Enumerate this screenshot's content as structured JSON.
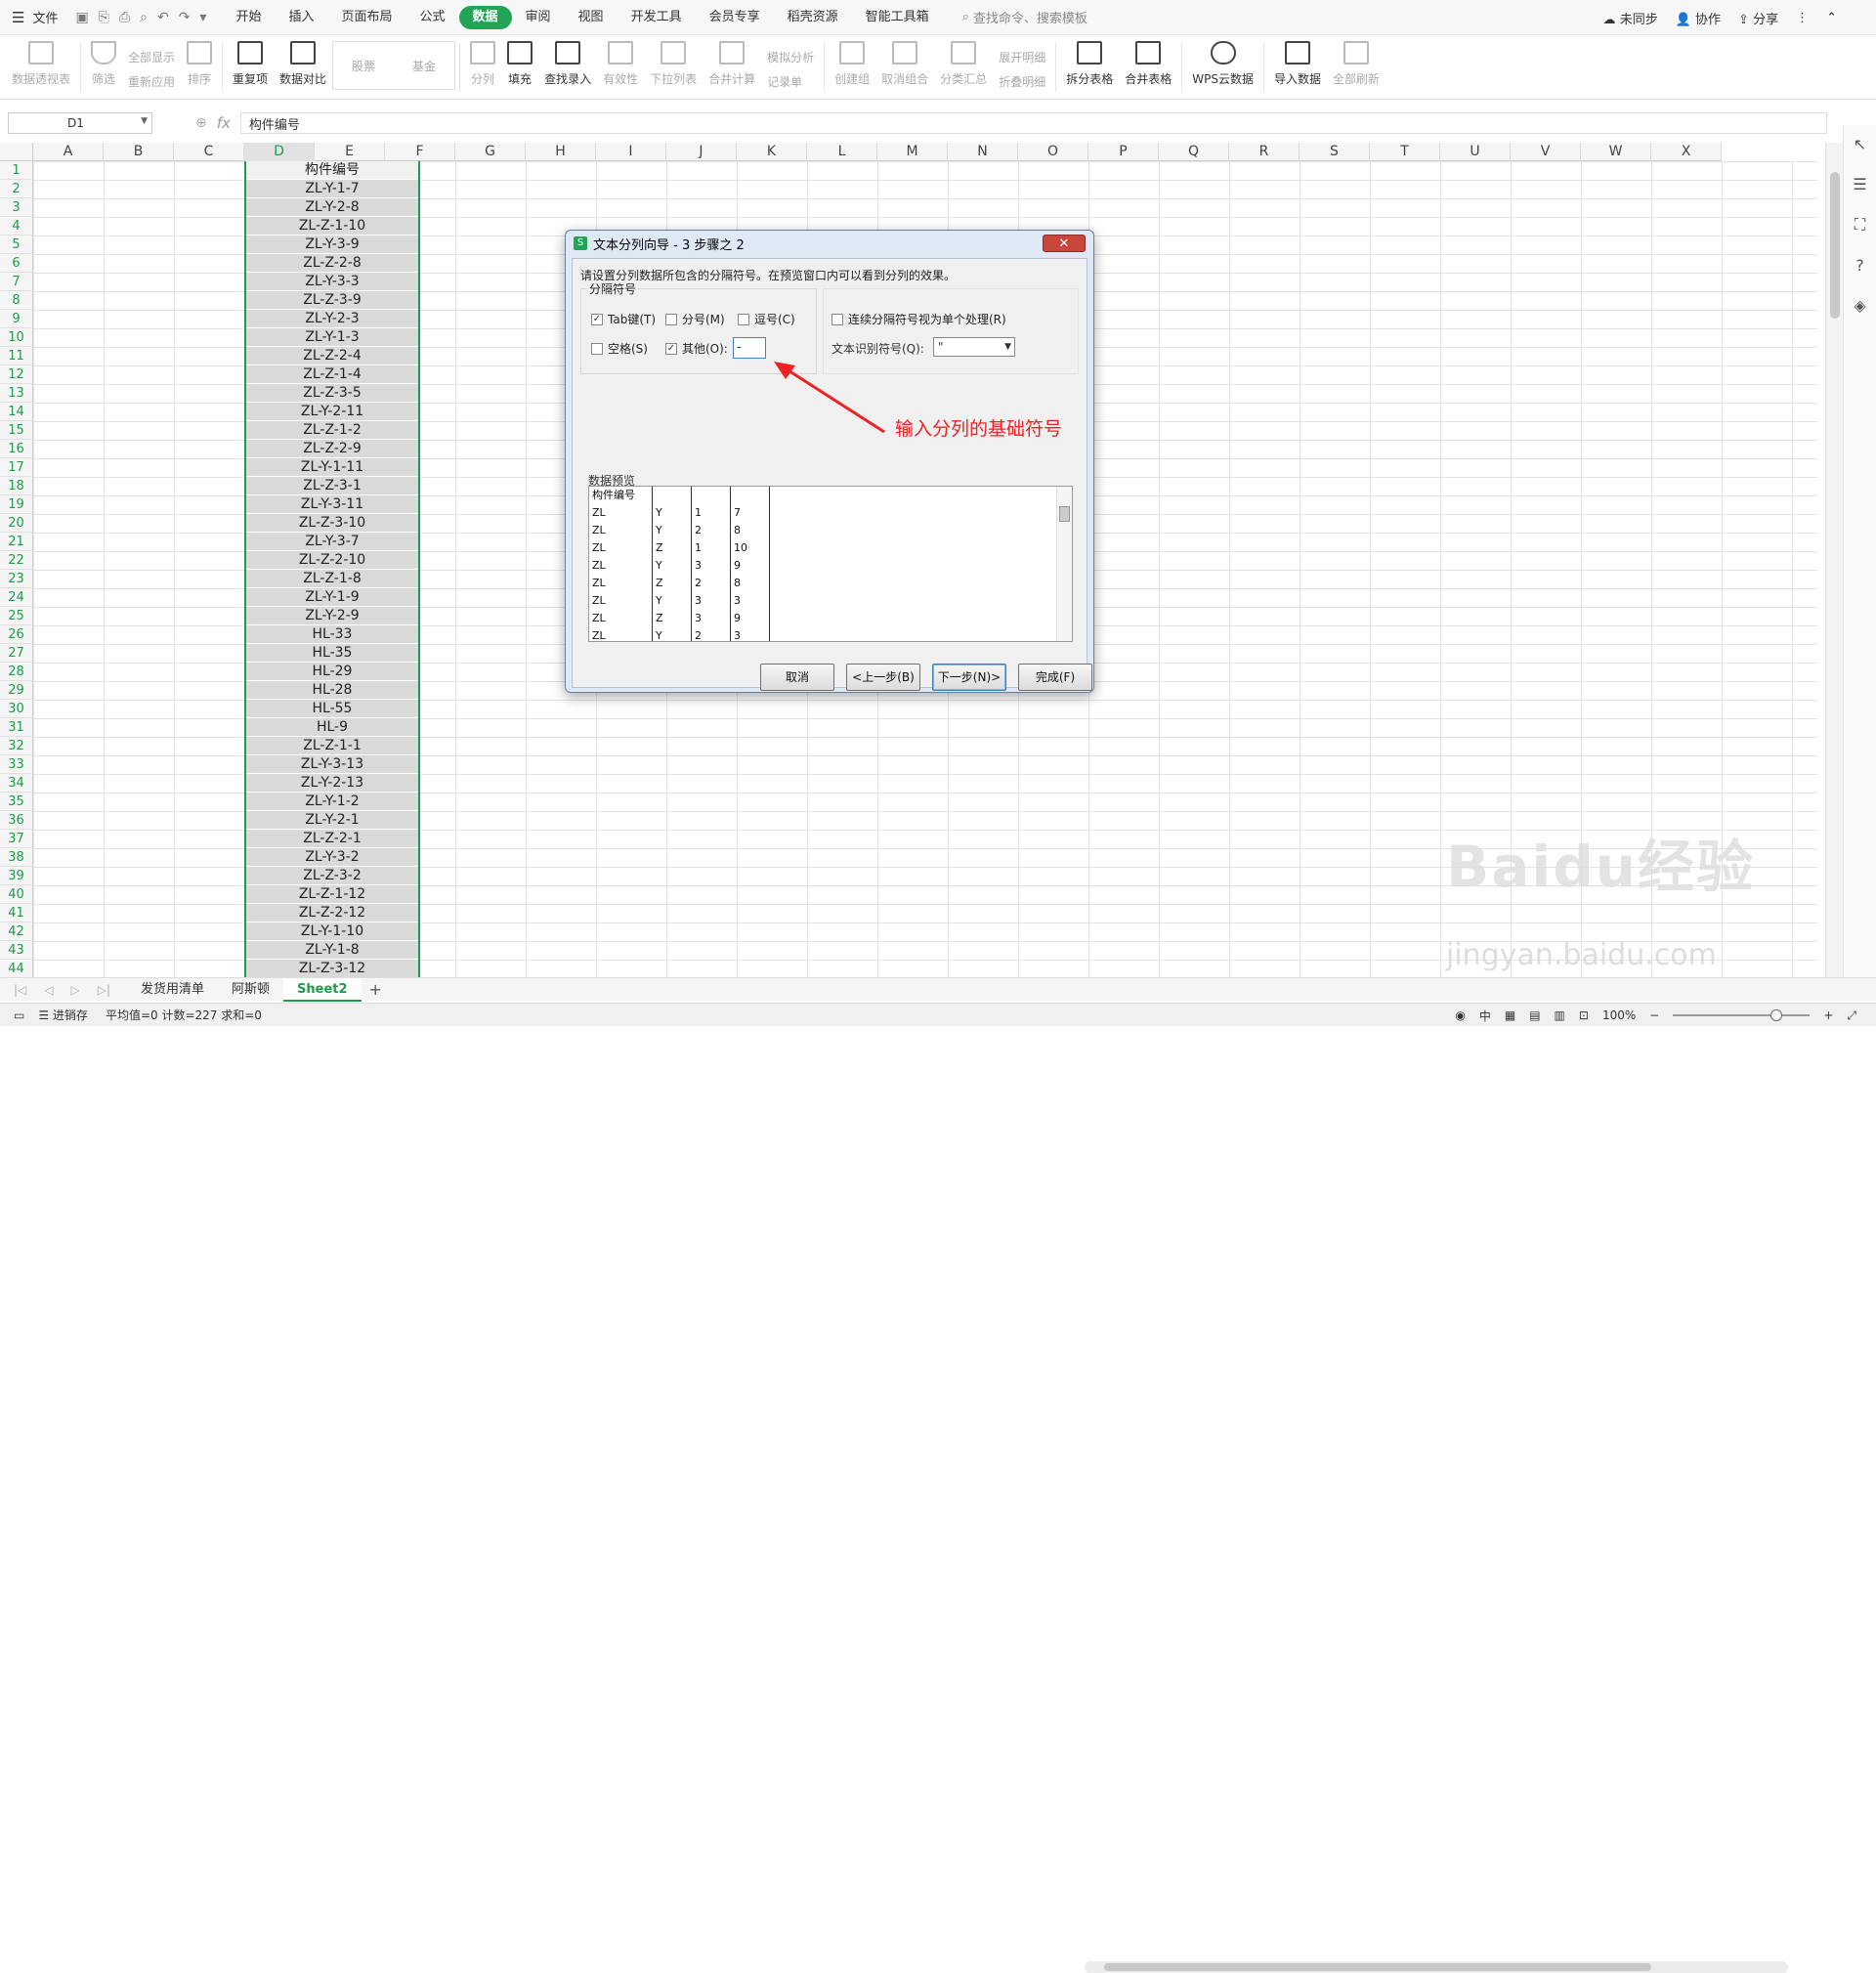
{
  "topbar": {
    "file_menu": "文件",
    "tabs": [
      "开始",
      "插入",
      "页面布局",
      "公式",
      "数据",
      "审阅",
      "视图",
      "开发工具",
      "会员专享",
      "稻壳资源",
      "智能工具箱"
    ],
    "active_tab": "数据",
    "search_placeholder": "查找命令、搜索模板",
    "sync": "未同步",
    "collab": "协作",
    "share": "分享"
  },
  "ribbon": {
    "pivot": "数据透视表",
    "filter": "筛选",
    "show_all": "全部显示",
    "reapply": "重新应用",
    "sort": "排序",
    "dup": "重复项",
    "compare": "数据对比",
    "stock": "股票",
    "fund": "基金",
    "split": "分列",
    "fill": "填充",
    "find_entry": "查找录入",
    "validity": "有效性",
    "dropdown": "下拉列表",
    "consolidate": "合并计算",
    "simulate": "模拟分析",
    "record": "记录单",
    "create_group": "创建组",
    "ungroup": "取消组合",
    "subtotal": "分类汇总",
    "expand": "展开明细",
    "collapse": "折叠明细",
    "split_table": "拆分表格",
    "merge_table": "合并表格",
    "wps_cloud": "WPS云数据",
    "import": "导入数据",
    "refresh": "全部刷新"
  },
  "formula_bar": {
    "cell": "D1",
    "fx": "fx",
    "value": "构件编号"
  },
  "columns": [
    "A",
    "B",
    "C",
    "D",
    "E",
    "F",
    "G",
    "H",
    "I",
    "J",
    "K",
    "L",
    "M",
    "N",
    "O",
    "P",
    "Q",
    "R",
    "S",
    "T",
    "U",
    "V",
    "W",
    "X"
  ],
  "selected_column": "D",
  "rows": [
    "1",
    "2",
    "3",
    "4",
    "5",
    "6",
    "7",
    "8",
    "9",
    "10",
    "11",
    "12",
    "13",
    "14",
    "15",
    "16",
    "17",
    "18",
    "19",
    "20",
    "21",
    "22",
    "23",
    "24",
    "25",
    "26",
    "27",
    "28",
    "29",
    "30",
    "31",
    "32",
    "33",
    "34",
    "35",
    "36",
    "37",
    "38",
    "39",
    "40",
    "41",
    "42",
    "43",
    "44"
  ],
  "d_values": [
    "构件编号",
    "ZL-Y-1-7",
    "ZL-Y-2-8",
    "ZL-Z-1-10",
    "ZL-Y-3-9",
    "ZL-Z-2-8",
    "ZL-Y-3-3",
    "ZL-Z-3-9",
    "ZL-Y-2-3",
    "ZL-Y-1-3",
    "ZL-Z-2-4",
    "ZL-Z-1-4",
    "ZL-Z-3-5",
    "ZL-Y-2-11",
    "ZL-Z-1-2",
    "ZL-Z-2-9",
    "ZL-Y-1-11",
    "ZL-Z-3-1",
    "ZL-Y-3-11",
    "ZL-Z-3-10",
    "ZL-Y-3-7",
    "ZL-Z-2-10",
    "ZL-Z-1-8",
    "ZL-Y-1-9",
    "ZL-Y-2-9",
    "HL-33",
    "HL-35",
    "HL-29",
    "HL-28",
    "HL-55",
    "HL-9",
    "ZL-Z-1-1",
    "ZL-Y-3-13",
    "ZL-Y-2-13",
    "ZL-Y-1-2",
    "ZL-Y-2-1",
    "ZL-Z-2-1",
    "ZL-Y-3-2",
    "ZL-Z-3-2",
    "ZL-Z-1-12",
    "ZL-Z-2-12",
    "ZL-Y-1-10",
    "ZL-Y-1-8",
    "ZL-Z-3-12"
  ],
  "dialog": {
    "title": "文本分列向导 - 3 步骤之 2",
    "close": "✕",
    "instruction": "请设置分列数据所包含的分隔符号。在预览窗口内可以看到分列的效果。",
    "group_label": "分隔符号",
    "tab": "Tab键(T)",
    "semicolon": "分号(M)",
    "comma": "逗号(C)",
    "space": "空格(S)",
    "other": "其他(O):",
    "other_value": "-",
    "consecutive": "连续分隔符号视为单个处理(R)",
    "qualifier_label": "文本识别符号(Q):",
    "qualifier_value": "\"",
    "preview_label": "数据预览",
    "preview_cols": [
      [
        "构件编号",
        "ZL",
        "ZL",
        "ZL",
        "ZL",
        "ZL",
        "ZL",
        "ZL",
        "ZL"
      ],
      [
        "",
        "Y",
        "Y",
        "Z",
        "Y",
        "Z",
        "Y",
        "Z",
        "Y"
      ],
      [
        "",
        "1",
        "2",
        "1",
        "3",
        "2",
        "3",
        "3",
        "2"
      ],
      [
        "",
        "7",
        "8",
        "10",
        "9",
        "8",
        "3",
        "9",
        "3"
      ]
    ],
    "btn_cancel": "取消",
    "btn_prev": "<上一步(B)",
    "btn_next": "下一步(N)>",
    "btn_finish": "完成(F)"
  },
  "annotation": "输入分列的基础符号",
  "sheets": [
    "发货用清单",
    "阿斯顿",
    "Sheet2"
  ],
  "active_sheet": "Sheet2",
  "status": {
    "inventory": "进销存",
    "stats": "平均值=0  计数=227  求和=0",
    "zoom": "100%"
  },
  "watermark": "Baidu经验",
  "watermark_url": "jingyan.baidu.com",
  "accent": "#23a455"
}
